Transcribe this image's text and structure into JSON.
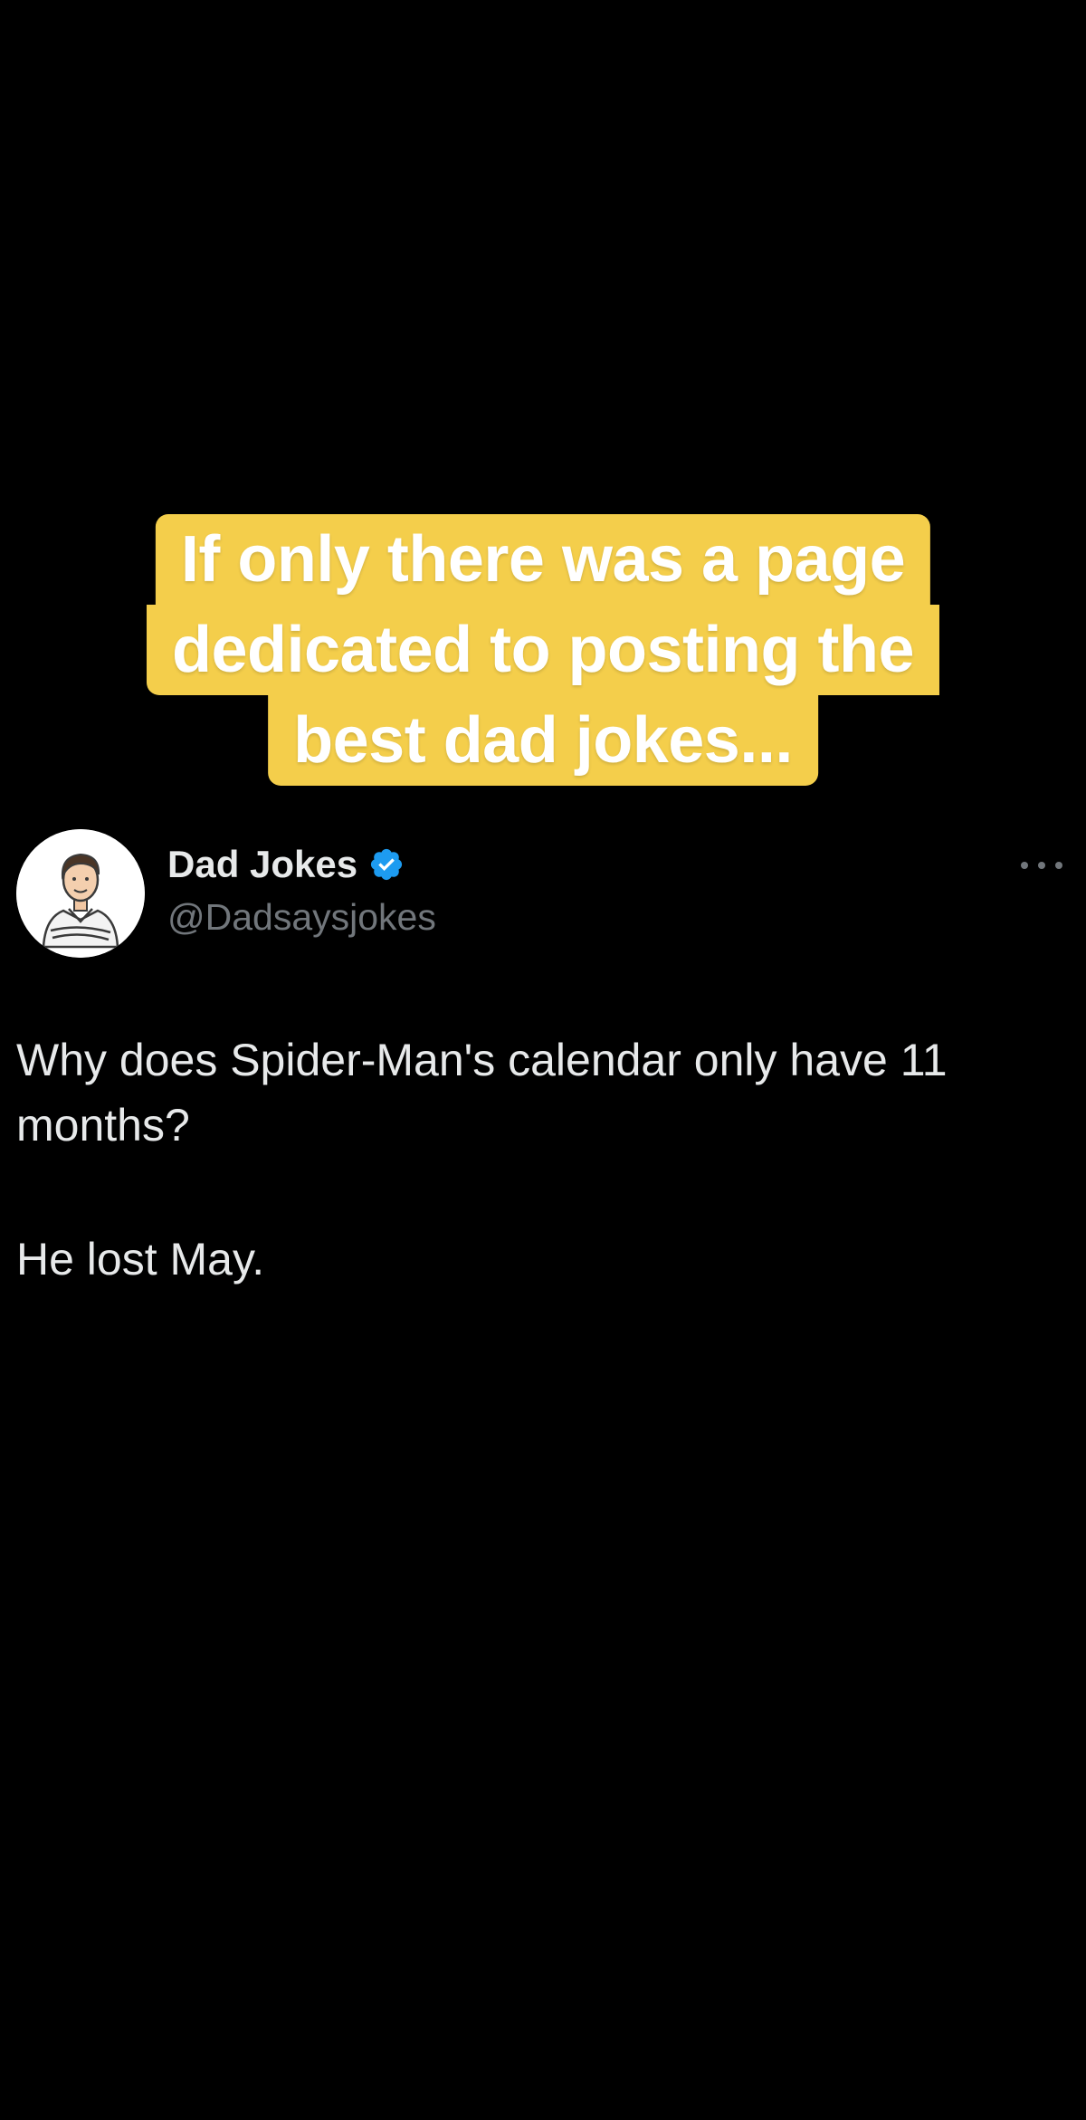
{
  "caption": {
    "lines": [
      "If only there was a page",
      "dedicated to posting the",
      "best dad jokes..."
    ],
    "background_color": "#f4ce4b",
    "text_color": "#ffffff"
  },
  "tweet": {
    "display_name": "Dad Jokes",
    "handle": "@Dadsaysjokes",
    "verified": true,
    "verified_icon": "verified-badge-icon",
    "more_icon": "more-options-icon",
    "body": {
      "question": "Why does Spider-Man's calendar only have 11 months?",
      "answer": "He lost May."
    }
  },
  "colors": {
    "background": "#000000",
    "primary_text": "#e7e9ea",
    "secondary_text": "#71767b",
    "verified_blue": "#1d9bf0"
  }
}
